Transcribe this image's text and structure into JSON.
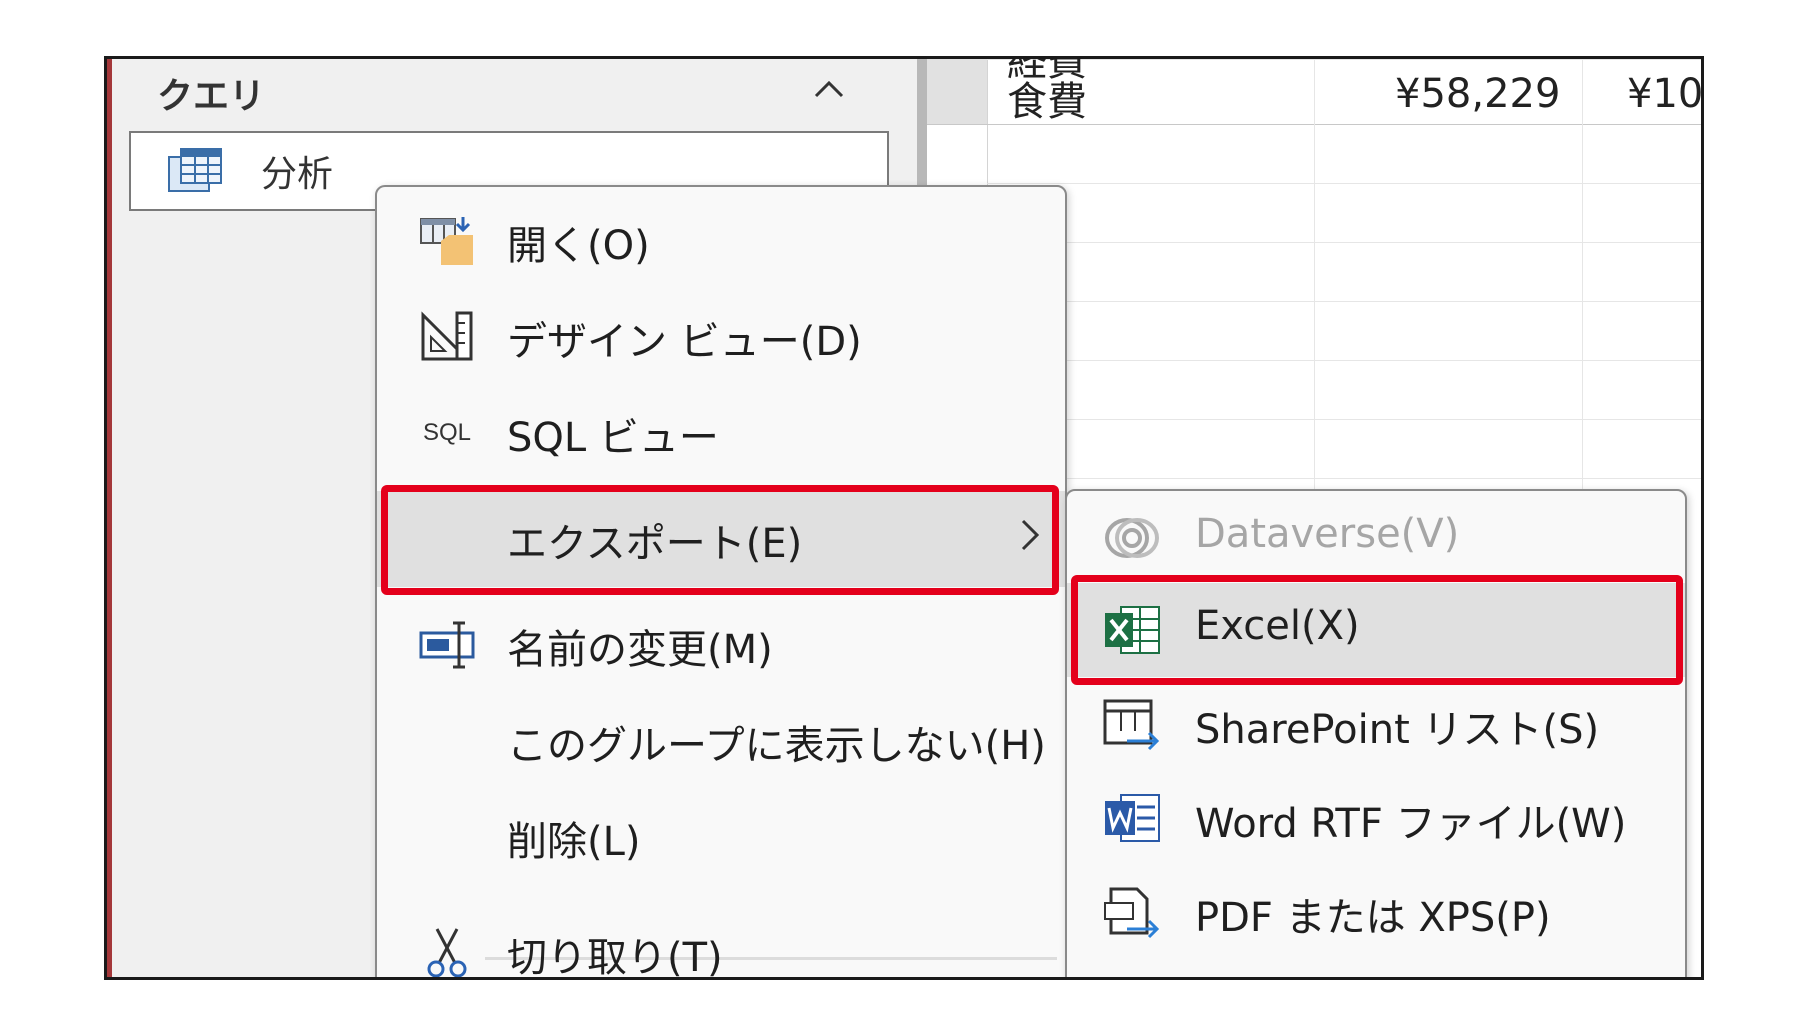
{
  "nav": {
    "header": "クエリ",
    "query_item": {
      "label": "分析"
    }
  },
  "sheet": {
    "row_cut_text": "経費",
    "row": {
      "label": "食費",
      "value1": "¥58,229",
      "value2": "¥10"
    }
  },
  "context_menu": {
    "items": [
      {
        "label": "開く(O)",
        "icon": "open-icon"
      },
      {
        "label": "デザイン ビュー(D)",
        "icon": "design-view-icon"
      },
      {
        "label": "SQL ビュー",
        "icon": "sql-icon",
        "icon_text": "SQL"
      },
      {
        "label": "エクスポート(E)",
        "icon": "none",
        "has_submenu": true
      },
      {
        "label": "名前の変更(M)",
        "icon": "rename-icon"
      },
      {
        "label": "このグループに表示しない(H)",
        "icon": "none"
      },
      {
        "label": "削除(L)",
        "icon": "none"
      },
      {
        "label": "切り取り(T)",
        "icon": "scissors-icon"
      }
    ]
  },
  "export_submenu": {
    "items": [
      {
        "label": "Dataverse(V)",
        "icon": "dataverse-icon",
        "disabled": true
      },
      {
        "label": "Excel(X)",
        "icon": "excel-icon"
      },
      {
        "label": "SharePoint リスト(S)",
        "icon": "sharepoint-list-icon"
      },
      {
        "label": "Word RTF ファイル(W)",
        "icon": "word-icon"
      },
      {
        "label": "PDF または XPS(P)",
        "icon": "pdf-xps-icon"
      }
    ]
  },
  "colors": {
    "highlight_border": "#e4001b",
    "excel_green": "#1d7044",
    "word_blue": "#2b5aa8",
    "access_accent": "#a4373a"
  }
}
